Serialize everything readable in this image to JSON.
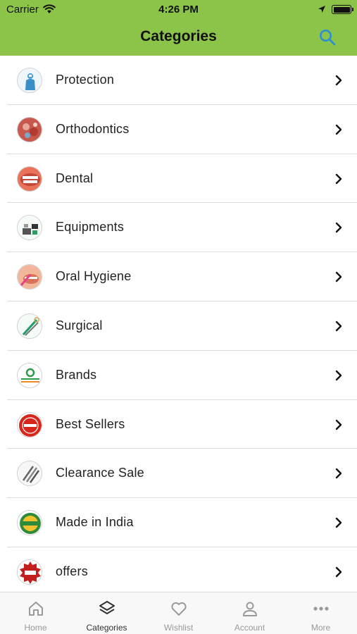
{
  "status_bar": {
    "carrier": "Carrier",
    "time": "4:26 PM",
    "battery_level": 1.0
  },
  "nav": {
    "title": "Categories",
    "search_icon": "search-icon"
  },
  "colors": {
    "header": "#8cc44a",
    "search_icon": "#2e8fd0",
    "chevron": "#111111",
    "tab_active": "#333333",
    "tab_inactive": "#9a9a9a"
  },
  "categories": [
    {
      "label": "Protection",
      "icon": "protection-icon"
    },
    {
      "label": "Orthodontics",
      "icon": "orthodontics-icon"
    },
    {
      "label": "Dental",
      "icon": "dental-icon"
    },
    {
      "label": "Equipments",
      "icon": "equipments-icon"
    },
    {
      "label": "Oral Hygiene",
      "icon": "oral-hygiene-icon"
    },
    {
      "label": "Surgical",
      "icon": "surgical-icon"
    },
    {
      "label": "Brands",
      "icon": "brands-icon"
    },
    {
      "label": "Best Sellers",
      "icon": "best-sellers-icon"
    },
    {
      "label": "Clearance Sale",
      "icon": "clearance-sale-icon"
    },
    {
      "label": "Made in India",
      "icon": "made-in-india-icon"
    },
    {
      "label": "offers",
      "icon": "offers-icon"
    }
  ],
  "tabs": [
    {
      "label": "Home",
      "icon": "home-icon",
      "active": false
    },
    {
      "label": "Categories",
      "icon": "layers-icon",
      "active": true
    },
    {
      "label": "Wishlist",
      "icon": "heart-icon",
      "active": false
    },
    {
      "label": "Account",
      "icon": "person-icon",
      "active": false
    },
    {
      "label": "More",
      "icon": "more-dots-icon",
      "active": false
    }
  ]
}
